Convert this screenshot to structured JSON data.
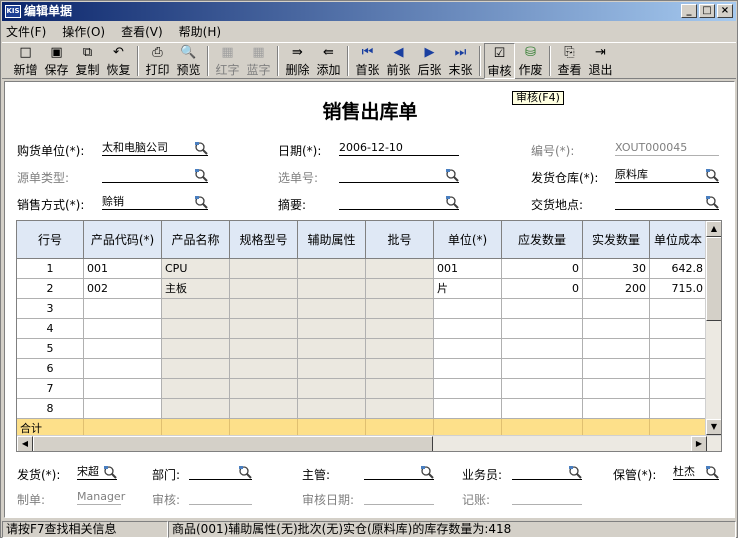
{
  "window": {
    "title": "编辑单据",
    "app_icon": "KIS"
  },
  "menu": [
    "文件(F)",
    "操作(O)",
    "查看(V)",
    "帮助(H)"
  ],
  "toolbar": [
    {
      "label": "新增",
      "icon": "□",
      "enabled": true
    },
    {
      "label": "保存",
      "icon": "▣",
      "enabled": true
    },
    {
      "label": "复制",
      "icon": "⧉",
      "enabled": true
    },
    {
      "label": "恢复",
      "icon": "↶",
      "enabled": true
    },
    {
      "label": "打印",
      "icon": "⎙",
      "enabled": true
    },
    {
      "label": "预览",
      "icon": "🔍",
      "enabled": true
    },
    {
      "label": "红字",
      "icon": "▦",
      "enabled": false
    },
    {
      "label": "蓝字",
      "icon": "▦",
      "enabled": false
    },
    {
      "label": "删除",
      "icon": "⇛",
      "enabled": true
    },
    {
      "label": "添加",
      "icon": "⇚",
      "enabled": true
    },
    {
      "label": "首张",
      "icon": "⏮",
      "enabled": true
    },
    {
      "label": "前张",
      "icon": "◀",
      "enabled": true
    },
    {
      "label": "后张",
      "icon": "▶",
      "enabled": true
    },
    {
      "label": "末张",
      "icon": "⏭",
      "enabled": true
    },
    {
      "label": "审核",
      "icon": "☑",
      "enabled": true,
      "active": true
    },
    {
      "label": "作废",
      "icon": "⛁",
      "enabled": true
    },
    {
      "label": "查看",
      "icon": "⎘",
      "enabled": true
    },
    {
      "label": "退出",
      "icon": "⇥",
      "enabled": true
    }
  ],
  "tooltip": "审核(F4)",
  "doc_title": "销售出库单",
  "header": {
    "buyer_label": "购货单位(*):",
    "buyer_value": "太和电脑公司",
    "date_label": "日期(*):",
    "date_value": "2006-12-10",
    "number_label": "编号(*):",
    "number_value": "XOUT000045",
    "source_type_label": "源单类型:",
    "source_type_value": "",
    "select_no_label": "选单号:",
    "select_no_value": "",
    "warehouse_label": "发货仓库(*):",
    "warehouse_value": "原料库",
    "sale_method_label": "销售方式(*):",
    "sale_method_value": "赊销",
    "summary_label": "摘要:",
    "summary_value": "",
    "delivery_label": "交货地点:",
    "delivery_value": ""
  },
  "grid": {
    "columns": [
      "行号",
      "产品代码(*)",
      "产品名称",
      "规格型号",
      "辅助属性",
      "批号",
      "单位(*)",
      "应发数量",
      "实发数量",
      "单位成本"
    ],
    "rows": [
      [
        "1",
        "001",
        "CPU",
        "",
        "",
        "",
        "001",
        "0",
        "30",
        "642.8"
      ],
      [
        "2",
        "002",
        "主板",
        "",
        "",
        "",
        "片",
        "0",
        "200",
        "715.0"
      ],
      [
        "3",
        "",
        "",
        "",
        "",
        "",
        "",
        "",
        "",
        ""
      ],
      [
        "4",
        "",
        "",
        "",
        "",
        "",
        "",
        "",
        "",
        ""
      ],
      [
        "5",
        "",
        "",
        "",
        "",
        "",
        "",
        "",
        "",
        ""
      ],
      [
        "6",
        "",
        "",
        "",
        "",
        "",
        "",
        "",
        "",
        ""
      ],
      [
        "7",
        "",
        "",
        "",
        "",
        "",
        "",
        "",
        "",
        ""
      ],
      [
        "8",
        "",
        "",
        "",
        "",
        "",
        "",
        "",
        "",
        ""
      ]
    ],
    "total_label": "合计"
  },
  "footer": {
    "shipper_label": "发货(*):",
    "shipper_value": "宋超",
    "dept_label": "部门:",
    "dept_value": "",
    "manager_label": "主管:",
    "manager_value": "",
    "salesman_label": "业务员:",
    "salesman_value": "",
    "keeper_label": "保管(*):",
    "keeper_value": "杜杰",
    "maker_label": "制单:",
    "maker_value": "Manager",
    "auditor_label": "审核:",
    "auditor_value": "",
    "audit_date_label": "审核日期:",
    "audit_date_value": "",
    "post_label": "记账:",
    "post_value": ""
  },
  "status": {
    "left": "请按F7查找相关信息",
    "right": "商品(001)辅助属性(无)批次(无)实仓(原料库)的库存数量为:418"
  }
}
